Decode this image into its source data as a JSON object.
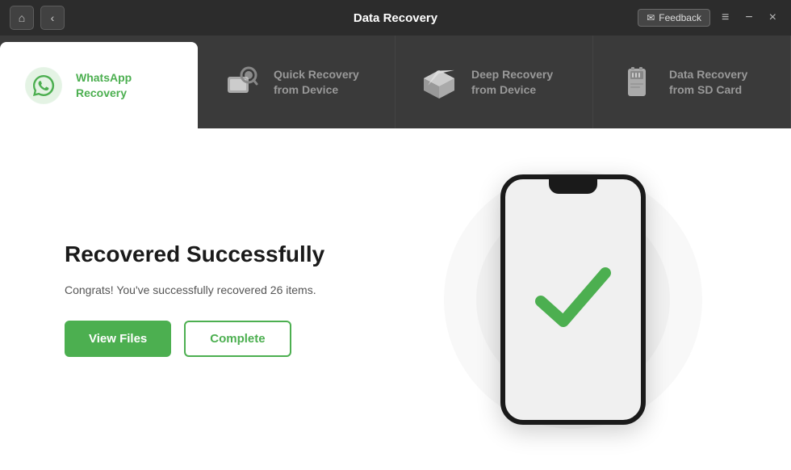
{
  "titleBar": {
    "title": "Data Recovery",
    "feedbackLabel": "Feedback",
    "homeIcon": "⌂",
    "backIcon": "‹",
    "menuIcon": "≡",
    "minimizeIcon": "−",
    "closeIcon": "×"
  },
  "nav": {
    "items": [
      {
        "id": "whatsapp",
        "label": "WhatsApp\nRecovery",
        "active": true
      },
      {
        "id": "quick-recovery",
        "label": "Quick Recovery\nfrom Device",
        "active": false
      },
      {
        "id": "deep-recovery",
        "label": "Deep Recovery\nfrom Device",
        "active": false
      },
      {
        "id": "sd-card",
        "label": "Data Recovery\nfrom SD Card",
        "active": false
      }
    ]
  },
  "main": {
    "successTitle": "Recovered Successfully",
    "successDesc": "Congrats! You've successfully recovered 26 items.",
    "viewFilesLabel": "View Files",
    "completeLabel": "Complete"
  }
}
